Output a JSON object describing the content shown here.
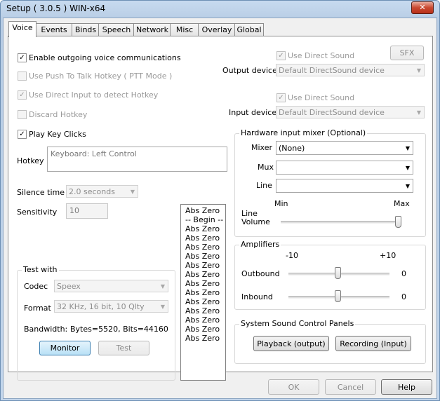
{
  "window": {
    "title": "Setup ( 3.0.5 ) WIN-x64",
    "close_glyph": "✕"
  },
  "tabs": [
    {
      "label": "Voice",
      "active": true
    },
    {
      "label": "Events"
    },
    {
      "label": "Binds"
    },
    {
      "label": "Speech"
    },
    {
      "label": "Network"
    },
    {
      "label": "Misc"
    },
    {
      "label": "Overlay"
    },
    {
      "label": "Global"
    }
  ],
  "voice": {
    "enable_outgoing": {
      "label": "Enable outgoing voice communications",
      "checked": true
    },
    "push_to_talk": {
      "label": "Use Push To Talk Hotkey ( PTT Mode )",
      "checked": false,
      "disabled": true
    },
    "direct_input": {
      "label": "Use Direct Input to detect Hotkey",
      "checked": true,
      "disabled": true
    },
    "discard_hotkey": {
      "label": "Discard Hotkey",
      "checked": false,
      "disabled": true
    },
    "play_key_clicks": {
      "label": "Play Key Clicks",
      "checked": true
    },
    "hotkey": {
      "label": "Hotkey",
      "value": "Keyboard: Left Control"
    },
    "silence_time": {
      "label": "Silence time",
      "value": "2.0 seconds"
    },
    "sensitivity": {
      "label": "Sensitivity",
      "value": "10"
    }
  },
  "output": {
    "sfx_label": "SFX",
    "use_direct_sound": {
      "label": "Use Direct Sound",
      "checked": true
    },
    "device_label": "Output device",
    "device_value": "Default DirectSound device"
  },
  "input": {
    "use_direct_sound": {
      "label": "Use Direct Sound",
      "checked": true
    },
    "device_label": "Input device",
    "device_value": "Default DirectSound device"
  },
  "mixer": {
    "group_label": "Hardware input mixer (Optional)",
    "mixer_label": "Mixer",
    "mixer_value": "(None)",
    "mux_label": "Mux",
    "mux_value": "",
    "line_label": "Line",
    "line_value": "",
    "min_label": "Min",
    "max_label": "Max",
    "line_volume_label_1": "Line",
    "line_volume_label_2": "Volume",
    "line_volume_level": 1.0
  },
  "amplifiers": {
    "group_label": "Amplifiers",
    "min_label": "-10",
    "max_label": "+10",
    "outbound_label": "Outbound",
    "outbound_value": "0",
    "inbound_label": "Inbound",
    "inbound_value": "0"
  },
  "level_list": [
    "Abs Zero",
    "-- Begin --",
    "Abs Zero",
    "Abs Zero",
    "Abs Zero",
    "Abs Zero",
    "Abs Zero",
    "Abs Zero",
    "Abs Zero",
    "Abs Zero",
    "Abs Zero",
    "Abs Zero",
    "Abs Zero",
    "Abs Zero",
    "Abs Zero"
  ],
  "test_with": {
    "group_label": "Test with",
    "codec_label": "Codec",
    "codec_value": "Speex",
    "format_label": "Format",
    "format_value": "32 KHz, 16 bit, 10 Qlty",
    "bandwidth_label": "Bandwidth:",
    "bandwidth_value": "Bytes=5520, Bits=44160",
    "monitor_label": "Monitor",
    "test_label": "Test"
  },
  "sound_panels": {
    "group_label": "System Sound Control Panels",
    "playback_label": "Playback (output)",
    "recording_label": "Recording (Input)"
  },
  "footer": {
    "ok_label": "OK",
    "cancel_label": "Cancel",
    "help_label": "Help"
  },
  "glyphs": {
    "check": "✓",
    "dropdown": "▼"
  }
}
